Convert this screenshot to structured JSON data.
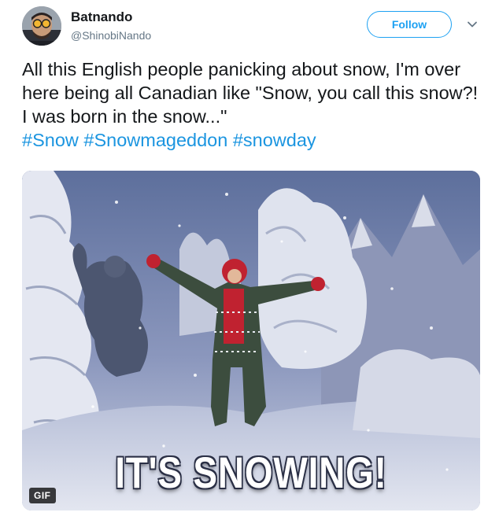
{
  "author": {
    "display_name": "Batnando",
    "handle": "@ShinobiNando"
  },
  "follow_button": {
    "label": "Follow"
  },
  "tweet": {
    "text": "All this English people panicking about snow, I'm over here being all Canadian like \"Snow, you call this snow?! I was born in the snow...\"",
    "hashtags": [
      "#Snow",
      "#Snowmageddon",
      "#snowday"
    ]
  },
  "media": {
    "badge": "GIF",
    "caption": "IT'S SNOWING!"
  },
  "colors": {
    "accent": "#1da1f2",
    "hashtag": "#1b95e0",
    "text": "#14171a",
    "secondary_text": "#657786"
  },
  "icons": {
    "menu": "chevron-down-icon"
  }
}
